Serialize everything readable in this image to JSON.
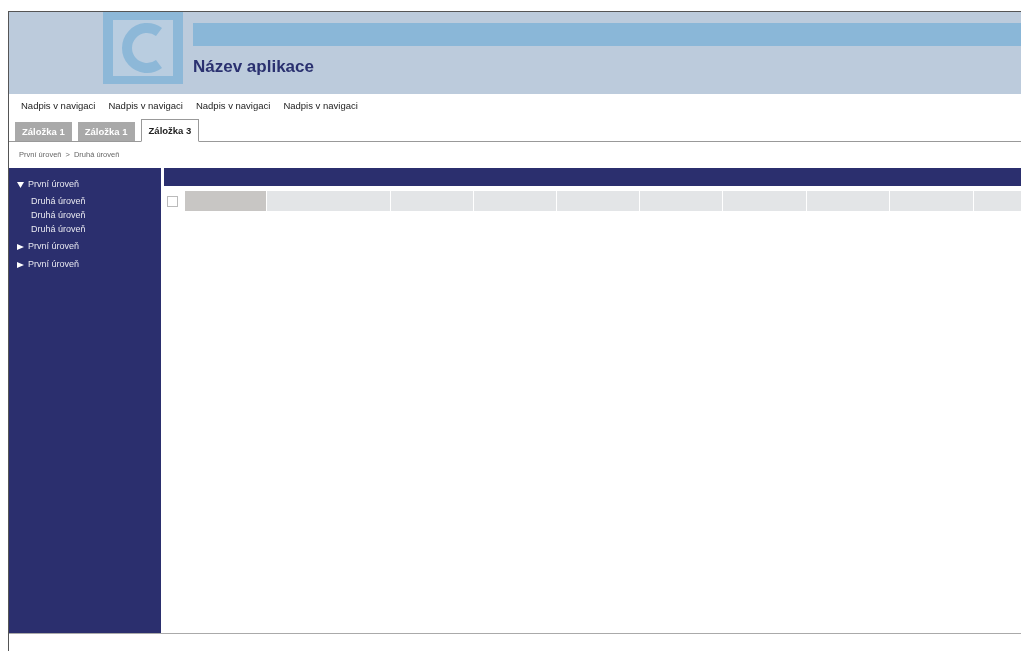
{
  "header": {
    "title": "Název aplikace"
  },
  "nav": [
    "Nadpis v navigaci",
    "Nadpis v navigaci",
    "Nadpis v navigaci",
    "Nadpis v navigaci"
  ],
  "tabs": [
    {
      "label": "Záložka 1",
      "selected": false
    },
    {
      "label": "Záložka 1",
      "selected": false
    },
    {
      "label": "Záložka 3",
      "selected": true
    }
  ],
  "breadcrumb": [
    "První úroveň",
    ">",
    "Druhá úroveň"
  ],
  "sidebar": {
    "items": [
      {
        "label": "První úroveň",
        "expanded": true,
        "children": [
          {
            "label": "Druhá úroveň"
          },
          {
            "label": "Druhá úroveň"
          },
          {
            "label": "Druhá úroveň"
          }
        ]
      },
      {
        "label": "První úroveň",
        "expanded": false
      },
      {
        "label": "První úroveň",
        "expanded": false
      }
    ]
  },
  "table": {
    "select_all_checked": false
  }
}
